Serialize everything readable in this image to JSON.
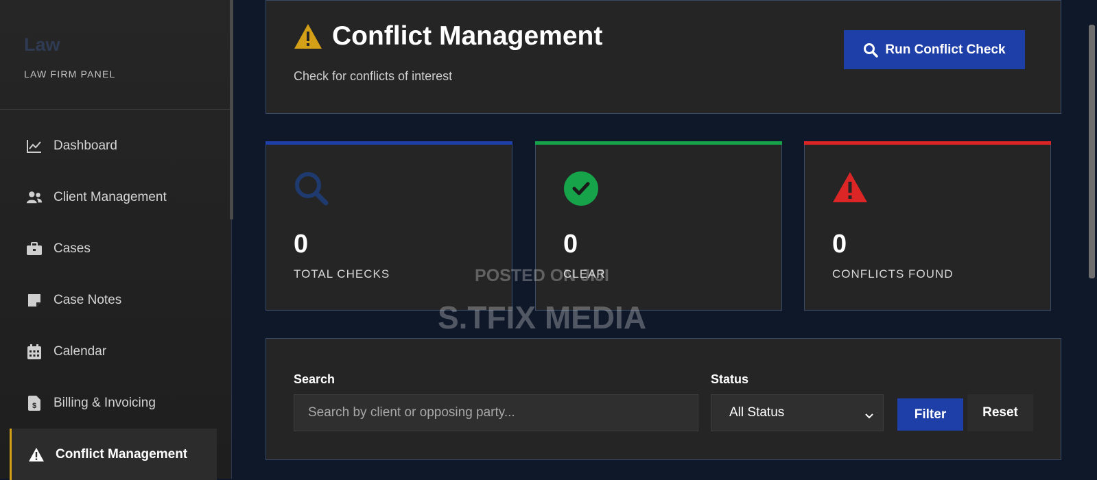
{
  "sidebar": {
    "brand": "Law",
    "panel_label": "LAW FIRM PANEL",
    "items": [
      {
        "label": "Dashboard",
        "icon": "chart-line-icon"
      },
      {
        "label": "Client Management",
        "icon": "users-icon"
      },
      {
        "label": "Cases",
        "icon": "briefcase-icon"
      },
      {
        "label": "Case Notes",
        "icon": "sticky-note-icon"
      },
      {
        "label": "Calendar",
        "icon": "calendar-icon"
      },
      {
        "label": "Billing & Invoicing",
        "icon": "invoice-icon"
      },
      {
        "label": "Conflict Management",
        "icon": "warning-icon",
        "active": true
      }
    ]
  },
  "header": {
    "title": "Conflict Management",
    "subtitle": "Check for conflicts of interest",
    "run_button": "Run Conflict Check"
  },
  "stats": [
    {
      "value": "0",
      "label": "TOTAL CHECKS",
      "color": "#1f3fa8",
      "icon": "search-icon"
    },
    {
      "value": "0",
      "label": "CLEAR",
      "color": "#16a34a",
      "icon": "check-circle-icon"
    },
    {
      "value": "0",
      "label": "CONFLICTS FOUND",
      "color": "#dc2626",
      "icon": "warning-icon"
    }
  ],
  "filters": {
    "search_label": "Search",
    "search_placeholder": "Search by client or opposing party...",
    "status_label": "Status",
    "status_value": "All Status",
    "filter_button": "Filter",
    "reset_button": "Reset"
  },
  "watermark": {
    "line1": "POSTED ON JIJI",
    "line2": "S.TFIX MEDIA"
  },
  "colors": {
    "accent": "#1f3fa8",
    "active_border": "#d4a017",
    "warning": "#d4a017"
  }
}
